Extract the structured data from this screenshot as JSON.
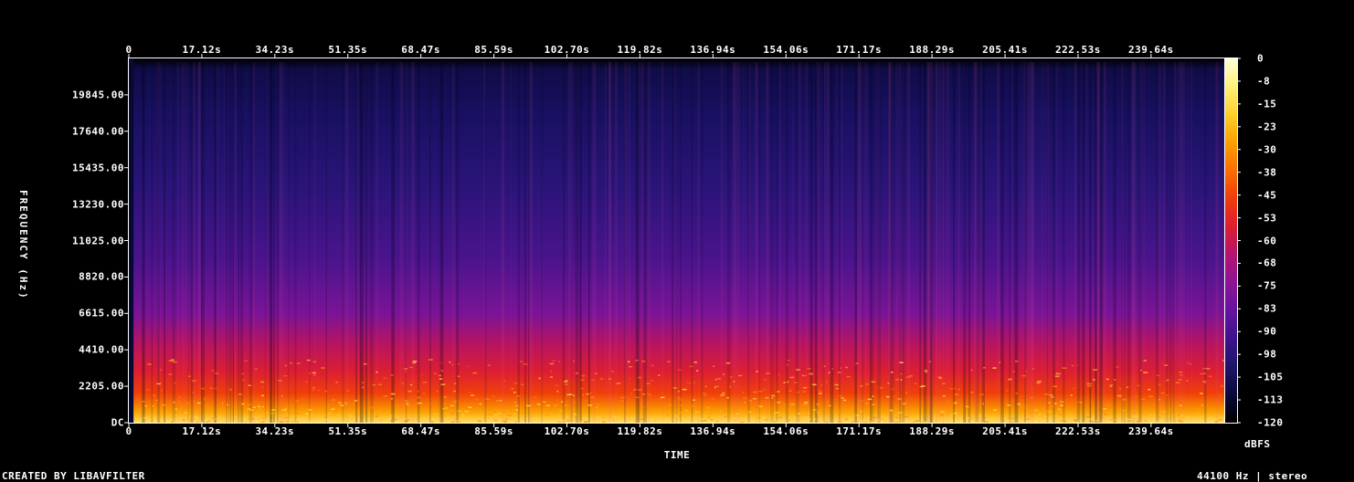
{
  "chart_data": {
    "type": "heatmap",
    "title": "",
    "xlabel": "TIME",
    "ylabel": "FREQUENCY (Hz)",
    "x_ticks": [
      "0",
      "17.12s",
      "34.23s",
      "51.35s",
      "68.47s",
      "85.59s",
      "102.70s",
      "119.82s",
      "136.94s",
      "154.06s",
      "171.17s",
      "188.29s",
      "205.41s",
      "222.53s",
      "239.64s"
    ],
    "x_tick_values": [
      0,
      17.12,
      34.23,
      51.35,
      68.47,
      85.59,
      102.7,
      119.82,
      136.94,
      154.06,
      171.17,
      188.29,
      205.41,
      222.53,
      239.64
    ],
    "xlim": [
      0,
      256.8
    ],
    "y_ticks": [
      "DC",
      "2205.00",
      "4410.00",
      "6615.00",
      "8820.00",
      "11025.00",
      "13230.00",
      "15435.00",
      "17640.00",
      "19845.00"
    ],
    "y_tick_values": [
      0,
      2205,
      4410,
      6615,
      8820,
      11025,
      13230,
      15435,
      17640,
      19845
    ],
    "ylim": [
      0,
      22050
    ],
    "colorbar": {
      "label": "dBFS",
      "ticks": [
        "0",
        "-8",
        "-15",
        "-23",
        "-30",
        "-38",
        "-45",
        "-53",
        "-60",
        "-68",
        "-75",
        "-83",
        "-90",
        "-98",
        "-105",
        "-113",
        "-120"
      ],
      "range": [
        -120,
        0
      ],
      "colors": [
        "#000000",
        "#0a0a3c",
        "#1e1468",
        "#3c148c",
        "#6414a0",
        "#8c1496",
        "#b4146e",
        "#dc1e32",
        "#f03c0a",
        "#fa6e00",
        "#fca000",
        "#fdd02a",
        "#fff07a",
        "#ffffd8"
      ]
    },
    "footer_left": "CREATED BY LIBAVFILTER",
    "footer_right": "44100 Hz | stereo"
  }
}
